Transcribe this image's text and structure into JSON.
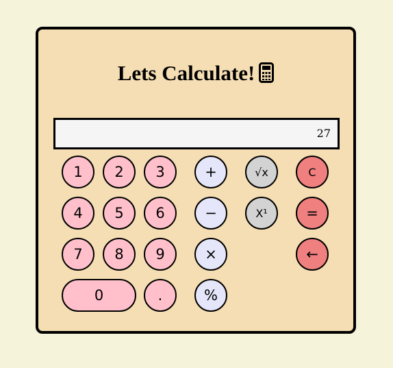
{
  "title": "Lets Calculate!",
  "title_icon": "calculator-icon",
  "display": {
    "value": "27"
  },
  "buttons": {
    "one": "1",
    "two": "2",
    "three": "3",
    "four": "4",
    "five": "5",
    "six": "6",
    "seven": "7",
    "eight": "8",
    "nine": "9",
    "zero": "0",
    "dot": ".",
    "plus": "+",
    "minus": "−",
    "multiply": "×",
    "percent": "%",
    "sqrt": "√x",
    "power": "X¹",
    "clear": "C",
    "equals": "=",
    "backspace": "←"
  },
  "colors": {
    "page_background": "#f5f3da",
    "calculator_background": "#f5deb3",
    "number_button": "#ffc0cb",
    "operator_button": "#e6e6fa",
    "function_button": "#d3d3d3",
    "action_button": "#f08080",
    "display_background": "#f5f5f5"
  }
}
